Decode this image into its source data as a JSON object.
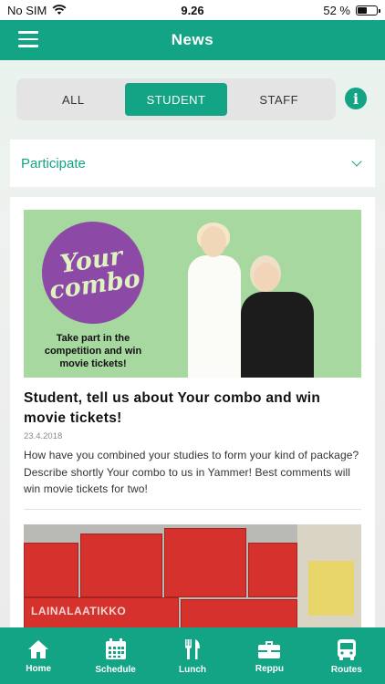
{
  "status_bar": {
    "carrier": "No SIM",
    "time": "9.26",
    "battery": "52 %",
    "battery_level": 0.52
  },
  "app_bar": {
    "title": "News",
    "menu_icon": "hamburger-menu-icon"
  },
  "filter": {
    "segments": [
      "ALL",
      "STUDENT",
      "STAFF"
    ],
    "selected": "STUDENT",
    "info_icon": "info-icon"
  },
  "category_dropdown": {
    "selected": "Participate",
    "icon": "chevron-down-icon"
  },
  "news": [
    {
      "image_text": {
        "line1": "Your",
        "line2": "combo",
        "caption": "Take part in the competition and win movie tickets!"
      },
      "title": "Student, tell us about Your combo and win movie tickets!",
      "date": "23.4.2018",
      "excerpt": "How have you combined your studies to form your kind of package? Describe shortly Your combo to us in Yammer! Best comments will win movie tickets for two!"
    },
    {
      "image_text": {
        "label": "LAINALAATIKKO"
      }
    }
  ],
  "tab_bar": {
    "items": [
      {
        "label": "Home",
        "icon": "home-icon"
      },
      {
        "label": "Schedule",
        "icon": "calendar-icon"
      },
      {
        "label": "Lunch",
        "icon": "fork-knife-icon"
      },
      {
        "label": "Reppu",
        "icon": "briefcase-icon"
      },
      {
        "label": "Routes",
        "icon": "bus-icon"
      }
    ]
  },
  "colors": {
    "accent": "#13a385",
    "purple": "#8d49a6",
    "crate_red": "#d6322d"
  }
}
